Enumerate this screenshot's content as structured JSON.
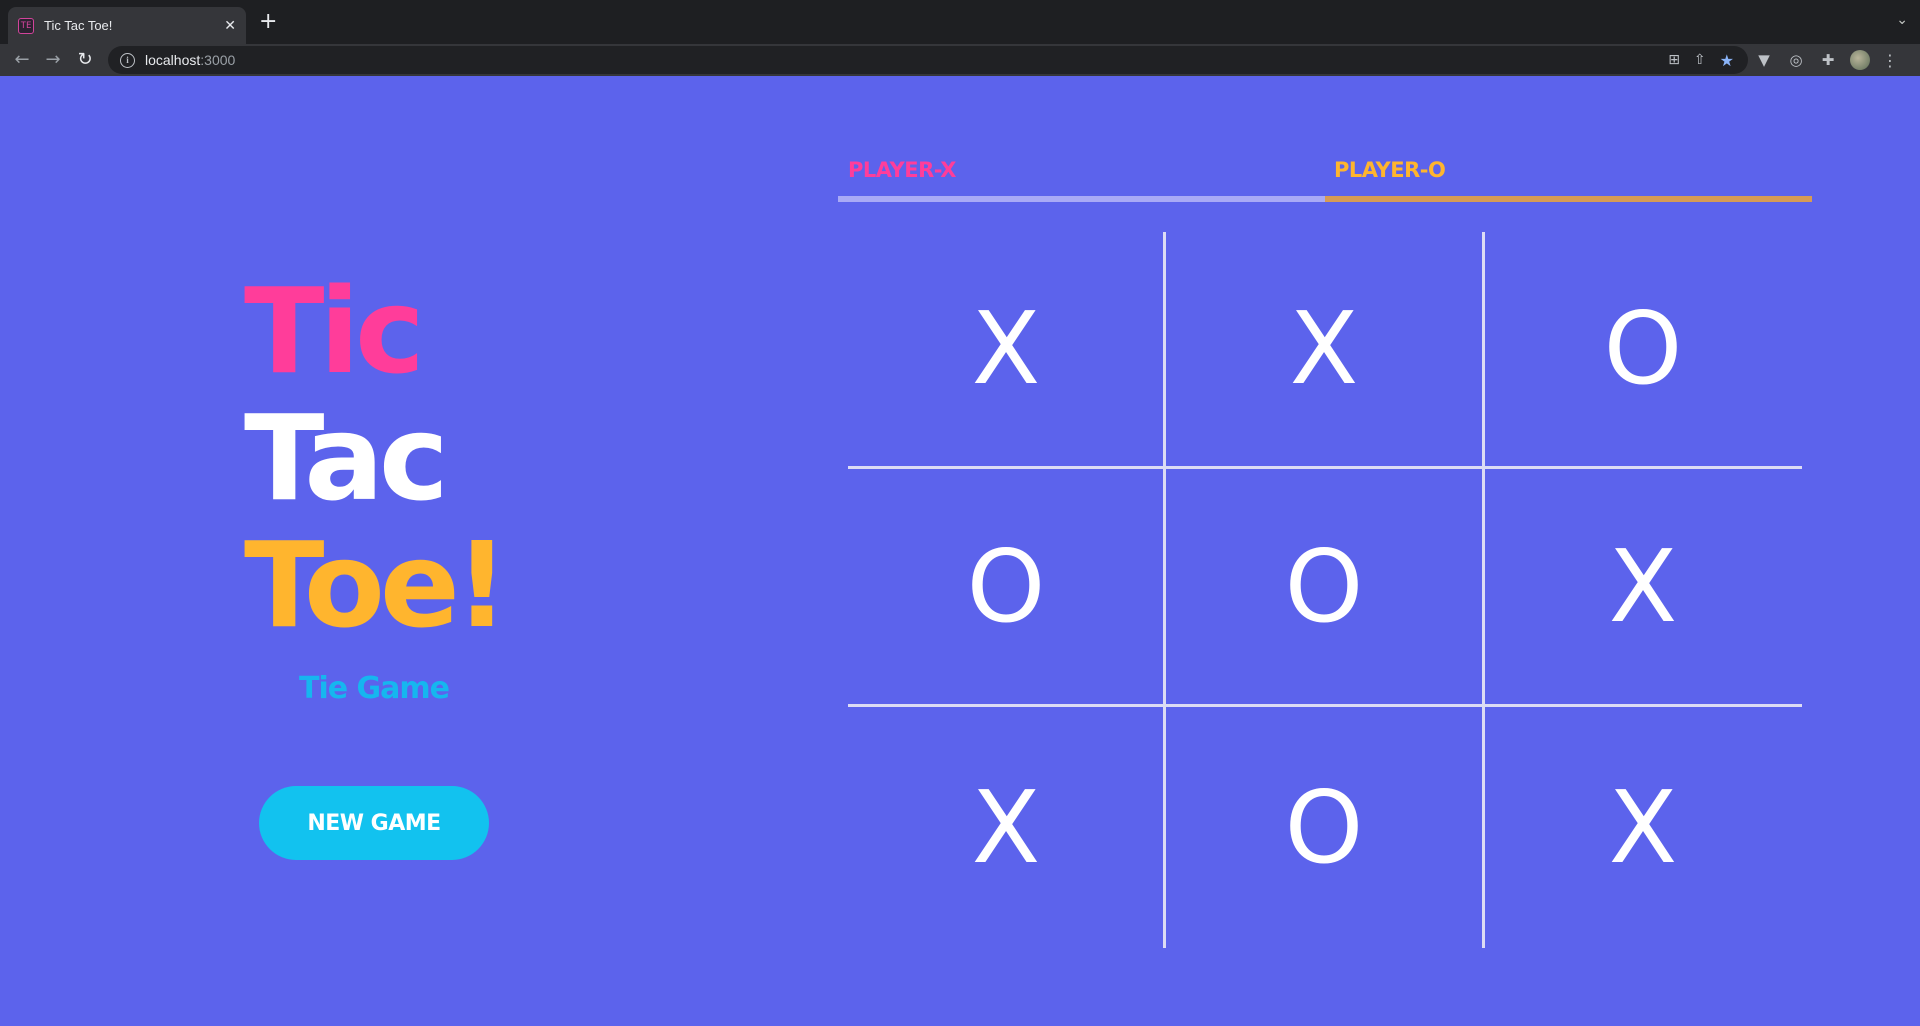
{
  "browser": {
    "tab_title": "Tic Tac Toe!",
    "tab_favicon": "TE",
    "new_tab_icon": "plus-icon",
    "url_host": "localhost",
    "url_port": ":3000"
  },
  "app": {
    "title": {
      "word1": "Tic",
      "word2": "Tac",
      "word3": "Toe!"
    },
    "status": "Tie Game",
    "new_game_label": "NEW GAME",
    "players": {
      "x": "PLAYER-X",
      "o": "PLAYER-O"
    },
    "board": [
      "X",
      "X",
      "O",
      "O",
      "O",
      "X",
      "X",
      "O",
      "X"
    ],
    "colors": {
      "background": "#5c63ec",
      "pink": "#ff3d9a",
      "orange": "#ffb52e",
      "cyan": "#12c2ef",
      "white": "#ffffff"
    }
  }
}
